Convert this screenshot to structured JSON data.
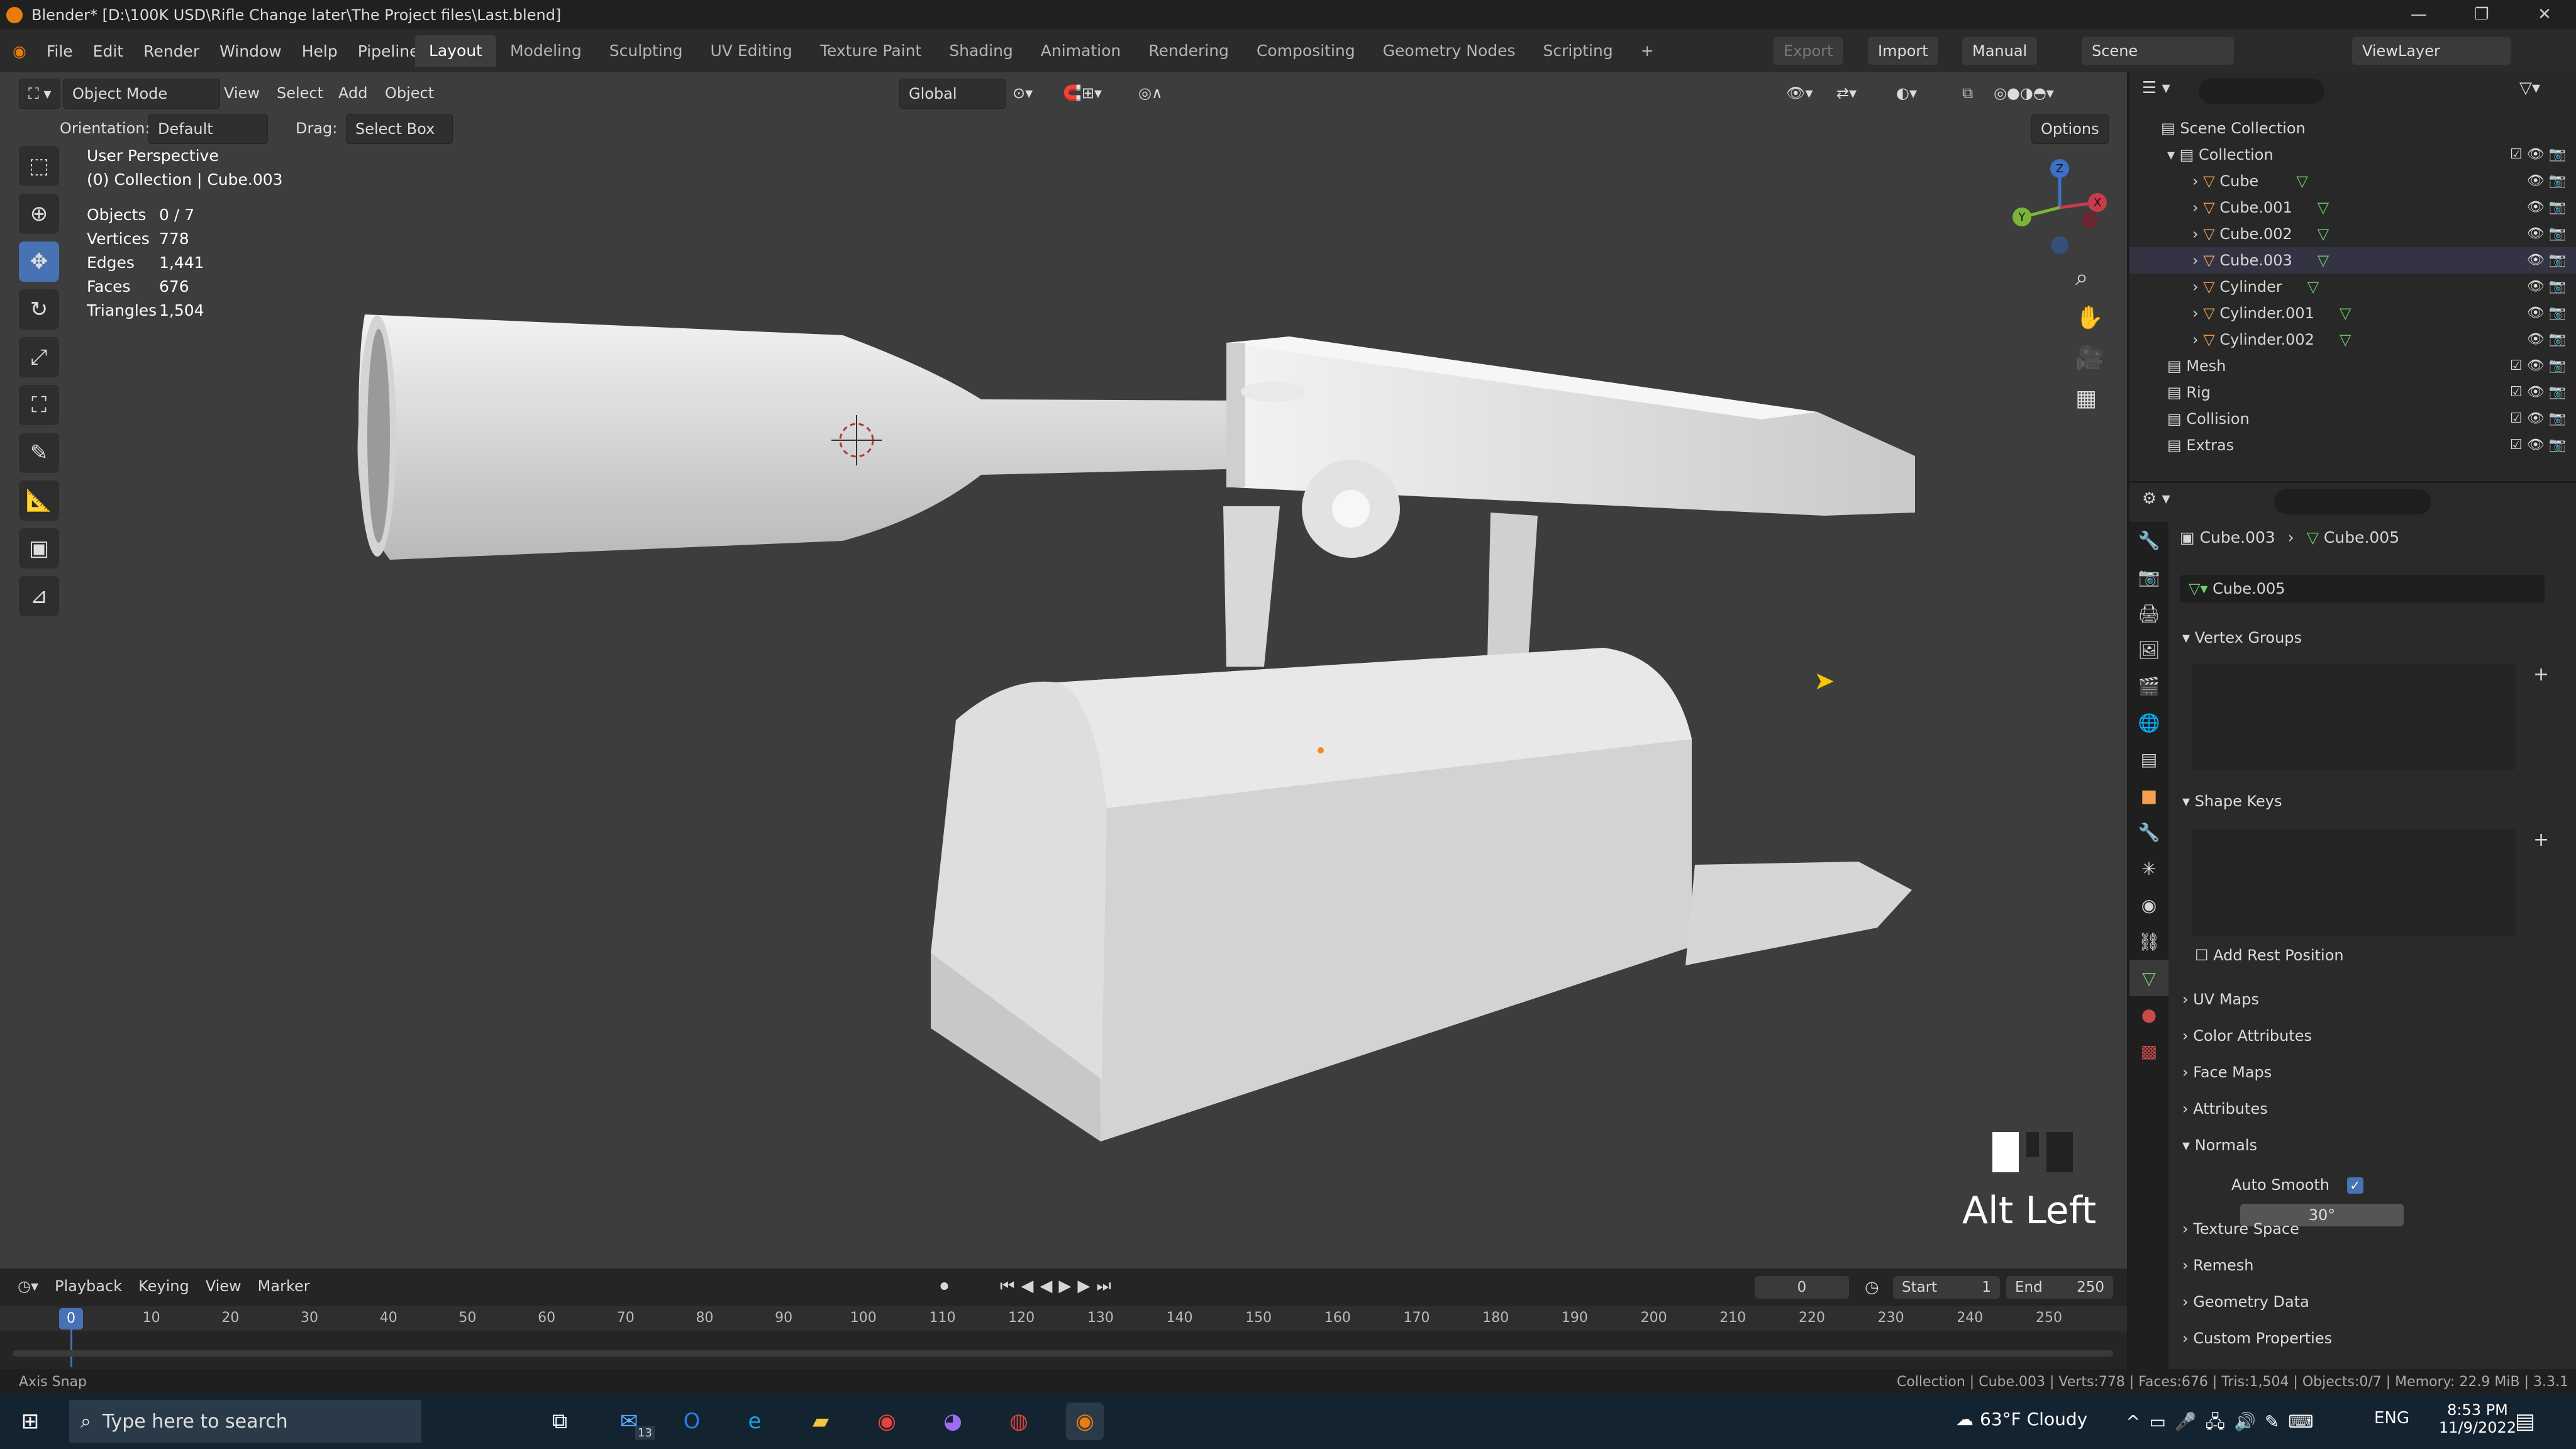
{
  "window": {
    "title": "Blender* [D:\\100K USD\\Rifle Change later\\The Project files\\Last.blend]",
    "controls": [
      "—",
      "❐",
      "✕"
    ]
  },
  "menu": [
    "File",
    "Edit",
    "Render",
    "Window",
    "Help",
    "Pipeline"
  ],
  "workspaces": [
    "Layout",
    "Modeling",
    "Sculpting",
    "UV Editing",
    "Texture Paint",
    "Shading",
    "Animation",
    "Rendering",
    "Compositing",
    "Geometry Nodes",
    "Scripting",
    "+"
  ],
  "topright": {
    "export": "Export",
    "import": "Import",
    "manual": "Manual",
    "scene": "Scene",
    "viewlayer": "ViewLayer"
  },
  "viewport_header": {
    "mode": "Object Mode",
    "menus": [
      "View",
      "Select",
      "Add",
      "Object"
    ],
    "orientation_label": "Orientation:",
    "orientation_value": "Default",
    "drag_label": "Drag:",
    "drag_value": "Select Box",
    "transform": "Global",
    "options": "Options"
  },
  "overlay": {
    "perspective": "User Perspective",
    "collection": "(0) Collection | Cube.003",
    "stats": [
      {
        "label": "Objects",
        "value": "0 / 7"
      },
      {
        "label": "Vertices",
        "value": "778"
      },
      {
        "label": "Edges",
        "value": "1,441"
      },
      {
        "label": "Faces",
        "value": "676"
      },
      {
        "label": "Triangles",
        "value": "1,504"
      }
    ],
    "key_hint": "Alt Left",
    "gizmo": {
      "x": "X",
      "y": "Y",
      "z": "Z"
    }
  },
  "outliner": {
    "root": "Scene Collection",
    "items": [
      {
        "name": "Collection",
        "kind": "collection"
      },
      {
        "name": "Cube",
        "kind": "mesh"
      },
      {
        "name": "Cube.001",
        "kind": "mesh"
      },
      {
        "name": "Cube.002",
        "kind": "mesh"
      },
      {
        "name": "Cube.003",
        "kind": "mesh"
      },
      {
        "name": "Cylinder",
        "kind": "mesh"
      },
      {
        "name": "Cylinder.001",
        "kind": "mesh"
      },
      {
        "name": "Cylinder.002",
        "kind": "mesh"
      },
      {
        "name": "Mesh",
        "kind": "collection"
      },
      {
        "name": "Rig",
        "kind": "collection"
      },
      {
        "name": "Collision",
        "kind": "collection"
      },
      {
        "name": "Extras",
        "kind": "collection"
      }
    ]
  },
  "properties": {
    "breadcrumb_object": "Cube.003",
    "breadcrumb_data": "Cube.005",
    "datablock": "Cube.005",
    "panels": [
      {
        "label": "Vertex Groups",
        "open": true
      },
      {
        "label": "Shape Keys",
        "open": true
      },
      {
        "label": "UV Maps",
        "open": false
      },
      {
        "label": "Color Attributes",
        "open": false
      },
      {
        "label": "Face Maps",
        "open": false
      },
      {
        "label": "Attributes",
        "open": false
      },
      {
        "label": "Normals",
        "open": true
      },
      {
        "label": "Texture Space",
        "open": false
      },
      {
        "label": "Remesh",
        "open": false
      },
      {
        "label": "Geometry Data",
        "open": false
      },
      {
        "label": "Custom Properties",
        "open": false
      }
    ],
    "add_rest_position": "Add Rest Position",
    "auto_smooth_label": "Auto Smooth",
    "auto_smooth_angle": "30°"
  },
  "timeline": {
    "menus": [
      "Playback",
      "Keying",
      "View",
      "Marker"
    ],
    "current_frame": "0",
    "start_label": "Start",
    "start": "1",
    "end_label": "End",
    "end": "250",
    "ticks": [
      "0",
      "10",
      "20",
      "30",
      "40",
      "50",
      "60",
      "70",
      "80",
      "90",
      "100",
      "110",
      "120",
      "130",
      "140",
      "150",
      "160",
      "170",
      "180",
      "190",
      "200",
      "210",
      "220",
      "230",
      "240",
      "250"
    ]
  },
  "statusbar": {
    "left": "Axis Snap",
    "right": "Collection | Cube.003 | Verts:778 | Faces:676 | Tris:1,504 | Objects:0/7 | Memory: 22.9 MiB | 3.3.1"
  },
  "taskbar": {
    "search": "Type here to search",
    "weather": "63°F Cloudy",
    "lang": "ENG",
    "time": "8:53 PM",
    "date": "11/9/2022",
    "mail_badge": "13"
  },
  "colors": {
    "accent": "#4772b3",
    "blender_orange": "#e87d0d",
    "viewport": "#3d3d3d"
  }
}
